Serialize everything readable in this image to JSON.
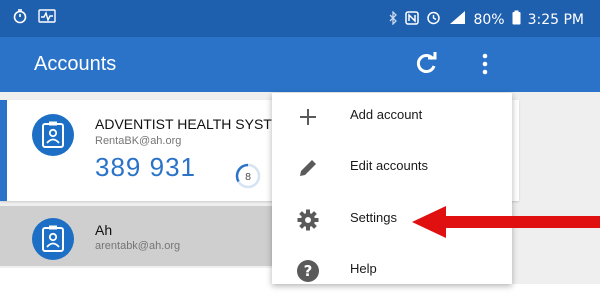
{
  "status_bar": {
    "battery": "80%",
    "time": "3:25 PM",
    "icons": [
      "stopwatch-icon",
      "activity-icon",
      "bluetooth-icon",
      "nfc-icon",
      "alarm-icon",
      "lte-signal-icon",
      "battery-icon"
    ]
  },
  "app_bar": {
    "title": "Accounts",
    "actions": [
      "refresh-icon",
      "overflow-menu-icon"
    ]
  },
  "accounts": [
    {
      "issuer": "ADVENTIST HEALTH SYSTEM",
      "email": "RentaBK@ah.org",
      "code": "389 931",
      "timer": "8"
    },
    {
      "issuer": "Ah",
      "email": "arentabk@ah.org"
    }
  ],
  "menu": {
    "items": [
      {
        "label": "Add account",
        "icon": "plus-icon"
      },
      {
        "label": "Edit accounts",
        "icon": "pencil-icon"
      },
      {
        "label": "Settings",
        "icon": "gear-icon"
      },
      {
        "label": "Help",
        "icon": "help-icon"
      }
    ]
  },
  "colors": {
    "status_bar": "#1e5fae",
    "app_bar": "#2a73c9",
    "accent": "#2a73c9",
    "annotation_arrow": "#e01010"
  }
}
